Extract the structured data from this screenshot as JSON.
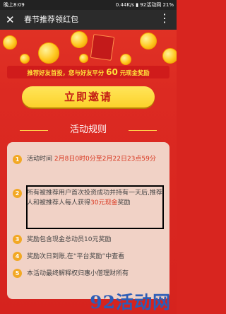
{
  "status_bar": {
    "time": "晚上8:09",
    "network": "0.44K/s",
    "carrier": "92活动网",
    "battery": "21%"
  },
  "titlebar": {
    "close_icon": "close-icon",
    "title": "春节推荐领红包",
    "more_icon": "more-icon"
  },
  "banner": {
    "text_prefix": "推荐好友首投，您与好友平分",
    "amount": "60",
    "text_suffix": "元现金奖励"
  },
  "invite_button": {
    "label": "立即邀请"
  },
  "rules": {
    "heading": "活动规则",
    "items": [
      {
        "num": "1",
        "text": "活动时间 ",
        "highlight": "2月8日0时0分至2月22日23点59分",
        "tail": ""
      },
      {
        "num": "2",
        "text": "所有被推荐用户首次投资成功并持有一天后,推荐人和被推荐人每人获得",
        "highlight": "30元现金",
        "tail": "奖励"
      },
      {
        "num": "3",
        "text": "奖励包含现金总动员10元奖励",
        "highlight": "",
        "tail": ""
      },
      {
        "num": "4",
        "text": "奖励次日到账,在“平台奖励”中查看",
        "highlight": "",
        "tail": ""
      },
      {
        "num": "5",
        "text": "本活动最终解释权归惠小僧理财所有",
        "highlight": "",
        "tail": ""
      }
    ]
  },
  "watermark": {
    "text": "92活动网"
  },
  "colors": {
    "background_red": "#dc2a22",
    "button_yellow": "#fcd22b",
    "highlight_red": "#d8361f",
    "panel_bg": "#f1d2c6"
  }
}
